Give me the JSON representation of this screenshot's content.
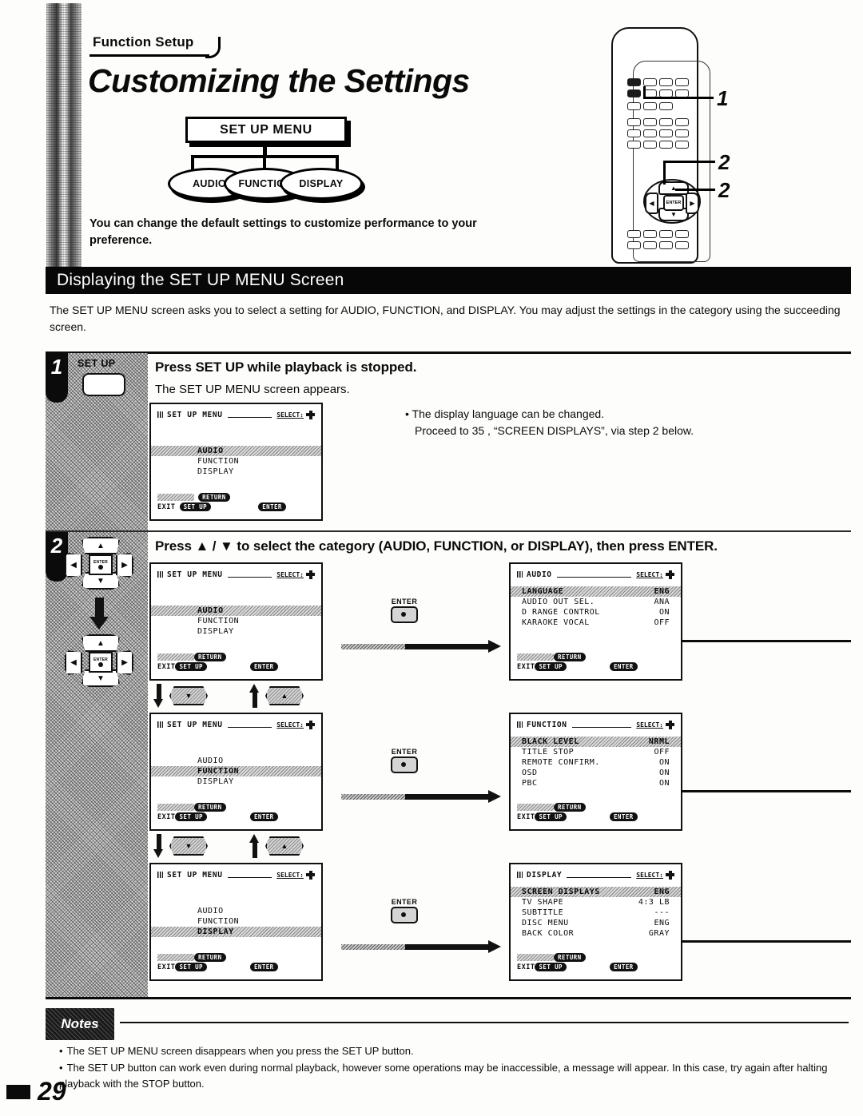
{
  "header": {
    "kicker": "Function Setup",
    "title": "Customizing the Settings",
    "diagram": {
      "root": "SET UP MENU",
      "branches": [
        "AUDIO",
        "FUNCTION",
        "DISPLAY"
      ]
    },
    "lead": "You can change the default settings to customize performance to your preference.",
    "callouts": [
      "1",
      "2",
      "2"
    ]
  },
  "section": {
    "heading": "Displaying the SET UP MENU Screen",
    "body": "The SET UP MENU screen asks you to select a setting for AUDIO, FUNCTION, and DISPLAY.  You may adjust the settings in the category using the succeeding screen."
  },
  "osd_common": {
    "select_label": "SELECT:",
    "return_label": "RETURN",
    "exit_label": "EXIT",
    "setup_label": "SET UP",
    "enter_label": "ENTER"
  },
  "step1": {
    "number": "1",
    "key_label": "SET UP",
    "title": "Press SET UP while playback is stopped.",
    "subtitle": "The SET UP MENU screen appears.",
    "screen": {
      "title": "SET UP MENU",
      "items": [
        {
          "label": "AUDIO",
          "value": "",
          "highlight": true
        },
        {
          "label": "FUNCTION",
          "value": "",
          "highlight": false
        },
        {
          "label": "DISPLAY",
          "value": "",
          "highlight": false
        }
      ]
    },
    "notes": [
      "The display language can be changed.",
      "Proceed to 35 , “SCREEN DISPLAYS”, via step 2 below."
    ],
    "note_page_ref": "35"
  },
  "step2": {
    "number": "2",
    "title": "Press ▲ / ▼ to select the category (AUDIO, FUNCTION, or DISPLAY), then press ENTER.",
    "rows": [
      {
        "left": {
          "title": "SET UP MENU",
          "items": [
            {
              "label": "AUDIO",
              "value": "",
              "highlight": true
            },
            {
              "label": "FUNCTION",
              "value": "",
              "highlight": false
            },
            {
              "label": "DISPLAY",
              "value": "",
              "highlight": false
            }
          ]
        },
        "enter": "ENTER",
        "right": {
          "title": "AUDIO",
          "items": [
            {
              "label": "LANGUAGE",
              "value": "ENG",
              "highlight": true
            },
            {
              "label": "AUDIO OUT SEL.",
              "value": "ANA",
              "highlight": false
            },
            {
              "label": "D RANGE CONTROL",
              "value": "ON",
              "highlight": false
            },
            {
              "label": "KARAOKE VOCAL",
              "value": "OFF",
              "highlight": false
            }
          ]
        }
      },
      {
        "left": {
          "title": "SET UP MENU",
          "items": [
            {
              "label": "AUDIO",
              "value": "",
              "highlight": false
            },
            {
              "label": "FUNCTION",
              "value": "",
              "highlight": true
            },
            {
              "label": "DISPLAY",
              "value": "",
              "highlight": false
            }
          ]
        },
        "enter": "ENTER",
        "right": {
          "title": "FUNCTION",
          "items": [
            {
              "label": "BLACK LEVEL",
              "value": "NRML",
              "highlight": true
            },
            {
              "label": "TITLE STOP",
              "value": "OFF",
              "highlight": false
            },
            {
              "label": "REMOTE CONFIRM.",
              "value": "ON",
              "highlight": false
            },
            {
              "label": "OSD",
              "value": "ON",
              "highlight": false
            },
            {
              "label": "PBC",
              "value": "ON",
              "highlight": false
            }
          ]
        }
      },
      {
        "left": {
          "title": "SET UP MENU",
          "items": [
            {
              "label": "AUDIO",
              "value": "",
              "highlight": false
            },
            {
              "label": "FUNCTION",
              "value": "",
              "highlight": false
            },
            {
              "label": "DISPLAY",
              "value": "",
              "highlight": true
            }
          ]
        },
        "enter": "ENTER",
        "right": {
          "title": "DISPLAY",
          "items": [
            {
              "label": "SCREEN DISPLAYS",
              "value": "ENG",
              "highlight": true
            },
            {
              "label": "TV SHAPE",
              "value": "4:3 LB",
              "highlight": false
            },
            {
              "label": "SUBTITLE",
              "value": "---",
              "highlight": false
            },
            {
              "label": "DISC MENU",
              "value": "ENG",
              "highlight": false
            },
            {
              "label": "BACK COLOR",
              "value": "GRAY",
              "highlight": false
            }
          ]
        }
      }
    ],
    "connectors": [
      {
        "down_key": "▼",
        "up_key": "▲"
      },
      {
        "down_key": "▼",
        "up_key": "▲"
      }
    ]
  },
  "notes": {
    "label": "Notes",
    "items": [
      "The SET UP MENU screen disappears when you press the SET UP button.",
      "The SET UP button can work even during normal playback, however some operations may be inaccessible, a message will appear. In this case, try again after halting playback with the STOP button."
    ]
  },
  "footer": {
    "page_number": "29"
  }
}
